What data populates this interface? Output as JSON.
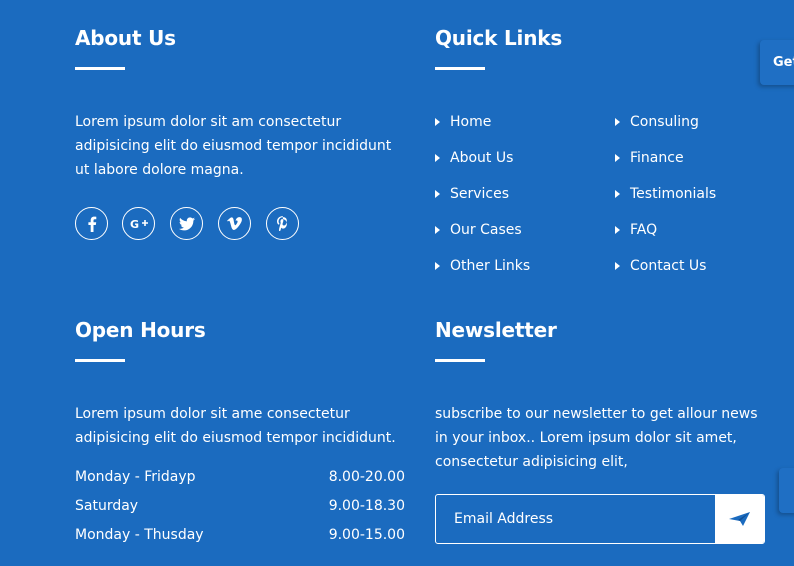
{
  "about": {
    "title": "About Us",
    "text": "Lorem ipsum dolor sit am consectetur adipisicing elit do eiusmod tempor incididunt ut labore dolore magna.",
    "social": [
      "facebook-icon",
      "google-plus-icon",
      "twitter-icon",
      "vimeo-icon",
      "pinterest-icon"
    ]
  },
  "quick_links": {
    "title": "Quick Links",
    "col1": [
      "Home",
      "About Us",
      "Services",
      "Our Cases",
      "Other Links"
    ],
    "col2": [
      "Consuling",
      "Finance",
      "Testimonials",
      "FAQ",
      "Contact Us"
    ]
  },
  "hours": {
    "title": "Open Hours",
    "text": "Lorem ipsum dolor sit ame consectetur adipisicing elit do eiusmod tempor incididunt.",
    "rows": [
      {
        "day": "Monday - Fridayp",
        "time": "8.00-20.00"
      },
      {
        "day": "Saturday",
        "time": "9.00-18.30"
      },
      {
        "day": "Monday - Thusday",
        "time": "9.00-15.00"
      }
    ]
  },
  "newsletter": {
    "title": "Newsletter",
    "text": "subscribe to our newsletter to get allour news in your inbox.. Lorem ipsum dolor sit amet, consectetur adipisicing elit,",
    "placeholder": "Email Address",
    "send_icon": "paper-plane-icon"
  },
  "side_tab": {
    "label": "Get"
  },
  "colors": {
    "background": "#1b6bbf",
    "accent": "#ffffff"
  }
}
